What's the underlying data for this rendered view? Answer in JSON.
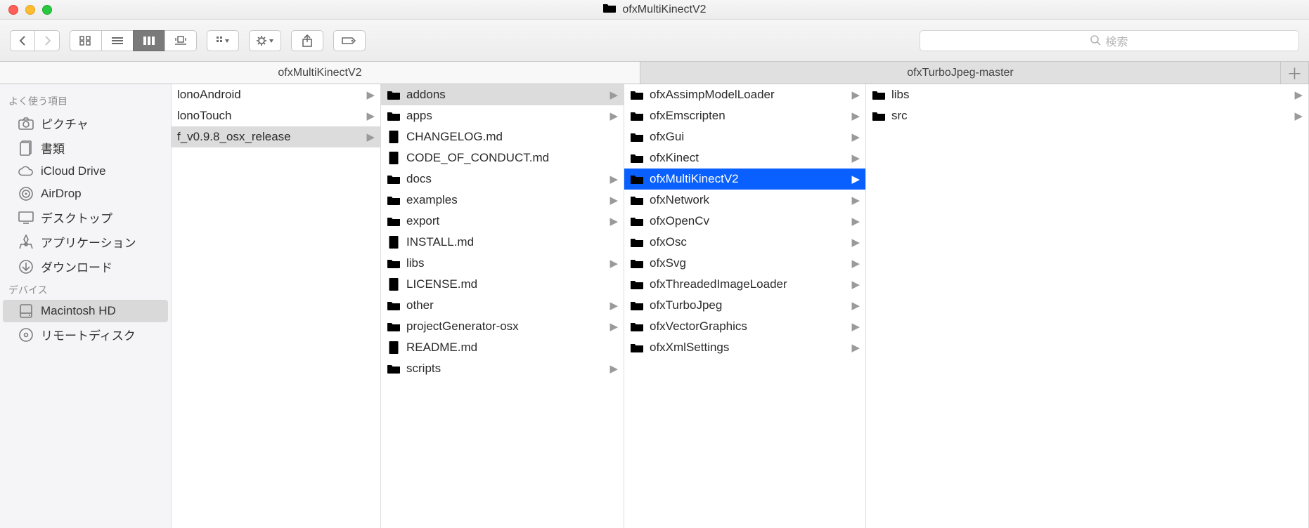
{
  "window": {
    "title": "ofxMultiKinectV2"
  },
  "search": {
    "placeholder": "検索"
  },
  "tabs": [
    {
      "label": "ofxMultiKinectV2",
      "active": true
    },
    {
      "label": "ofxTurboJpeg-master",
      "active": false
    }
  ],
  "sidebar": {
    "sections": [
      {
        "header": "よく使う項目",
        "items": [
          {
            "label": "ピクチャ",
            "icon": "camera"
          },
          {
            "label": "書類",
            "icon": "doc"
          },
          {
            "label": "iCloud Drive",
            "icon": "cloud"
          },
          {
            "label": "AirDrop",
            "icon": "airdrop"
          },
          {
            "label": "デスクトップ",
            "icon": "desktop"
          },
          {
            "label": "アプリケーション",
            "icon": "apps"
          },
          {
            "label": "ダウンロード",
            "icon": "download"
          }
        ]
      },
      {
        "header": "デバイス",
        "items": [
          {
            "label": "Macintosh HD",
            "icon": "hdd",
            "selected": true
          },
          {
            "label": "リモートディスク",
            "icon": "disc"
          }
        ]
      }
    ]
  },
  "columns": [
    {
      "items": [
        {
          "label": "lonoAndroid",
          "type": "folder",
          "arrow": true,
          "clip": true
        },
        {
          "label": "lonoTouch",
          "type": "folder",
          "arrow": true,
          "clip": true
        },
        {
          "label": "f_v0.9.8_osx_release",
          "type": "folder",
          "arrow": true,
          "selected": "gray",
          "clip": true
        }
      ]
    },
    {
      "items": [
        {
          "label": "addons",
          "type": "folder",
          "arrow": true,
          "selected": "gray"
        },
        {
          "label": "apps",
          "type": "folder",
          "arrow": true
        },
        {
          "label": "CHANGELOG.md",
          "type": "doc"
        },
        {
          "label": "CODE_OF_CONDUCT.md",
          "type": "doc"
        },
        {
          "label": "docs",
          "type": "folder",
          "arrow": true
        },
        {
          "label": "examples",
          "type": "folder",
          "arrow": true
        },
        {
          "label": "export",
          "type": "folder",
          "arrow": true
        },
        {
          "label": "INSTALL.md",
          "type": "doc"
        },
        {
          "label": "libs",
          "type": "folder",
          "arrow": true
        },
        {
          "label": "LICENSE.md",
          "type": "doc"
        },
        {
          "label": "other",
          "type": "folder",
          "arrow": true
        },
        {
          "label": "projectGenerator-osx",
          "type": "folder",
          "arrow": true
        },
        {
          "label": "README.md",
          "type": "doc"
        },
        {
          "label": "scripts",
          "type": "folder",
          "arrow": true
        }
      ]
    },
    {
      "items": [
        {
          "label": "ofxAssimpModelLoader",
          "type": "folder",
          "arrow": true
        },
        {
          "label": "ofxEmscripten",
          "type": "folder",
          "arrow": true
        },
        {
          "label": "ofxGui",
          "type": "folder",
          "arrow": true
        },
        {
          "label": "ofxKinect",
          "type": "folder",
          "arrow": true
        },
        {
          "label": "ofxMultiKinectV2",
          "type": "folder",
          "arrow": true,
          "selected": "blue"
        },
        {
          "label": "ofxNetwork",
          "type": "folder",
          "arrow": true
        },
        {
          "label": "ofxOpenCv",
          "type": "folder",
          "arrow": true
        },
        {
          "label": "ofxOsc",
          "type": "folder",
          "arrow": true
        },
        {
          "label": "ofxSvg",
          "type": "folder",
          "arrow": true
        },
        {
          "label": "ofxThreadedImageLoader",
          "type": "folder",
          "arrow": true
        },
        {
          "label": "ofxTurboJpeg",
          "type": "folder",
          "arrow": true
        },
        {
          "label": "ofxVectorGraphics",
          "type": "folder",
          "arrow": true
        },
        {
          "label": "ofxXmlSettings",
          "type": "folder",
          "arrow": true
        }
      ]
    },
    {
      "items": [
        {
          "label": "libs",
          "type": "folder",
          "arrow": true
        },
        {
          "label": "src",
          "type": "folder",
          "arrow": true
        }
      ]
    }
  ]
}
